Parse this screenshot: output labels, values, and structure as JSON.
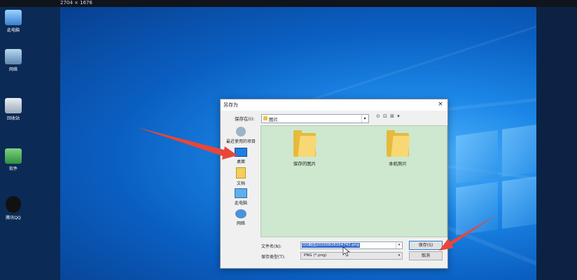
{
  "top_strip": {
    "dimensions": "2704 × 1676"
  },
  "desktop_icons": [
    {
      "label": "此电脑"
    },
    {
      "label": "网络"
    },
    {
      "label": "回收站"
    },
    {
      "label": "软件"
    },
    {
      "label": "腾讯QQ"
    }
  ],
  "dialog": {
    "title": "另存为",
    "save_in_label": "保存在(I):",
    "save_in_value": "图片",
    "toolbar_icons": "⊙ ⊡ ⊞ ▾",
    "places": [
      {
        "label": "最近使用的项目",
        "icon": "recent-icon"
      },
      {
        "label": "桌面",
        "icon": "desktop-icon"
      },
      {
        "label": "文档",
        "icon": "documents-icon"
      },
      {
        "label": "此电脑",
        "icon": "computer-icon"
      },
      {
        "label": "网络",
        "icon": "network-icon"
      }
    ],
    "files": [
      {
        "label": "保存的图片"
      },
      {
        "label": "本机照片"
      }
    ],
    "filename_label": "文件名(N):",
    "filename_value": "QQ截图20200828164742.png",
    "filetype_label": "保存类型(T):",
    "filetype_value": "PNG (*.png)",
    "save_button": "保存(S)",
    "cancel_button": "取消"
  },
  "colors": {
    "arrow": "#e8463a",
    "file_pane_bg": "#cde8cf",
    "selection": "#3a6fd0"
  }
}
